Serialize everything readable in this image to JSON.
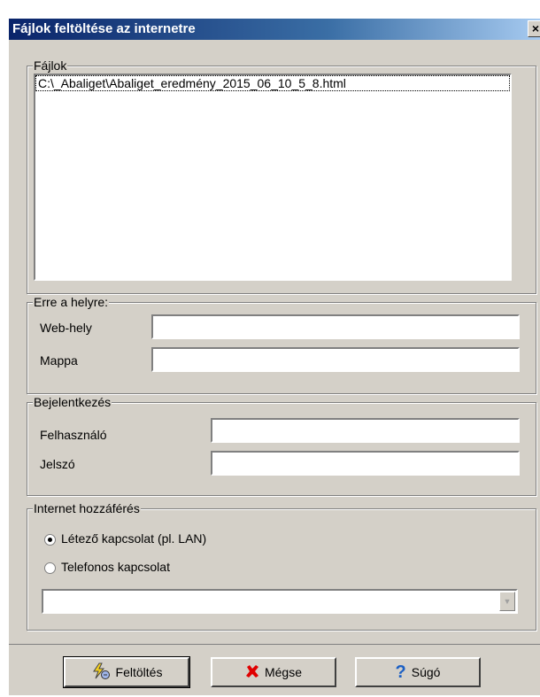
{
  "window": {
    "title": "Fájlok feltöltése az internetre",
    "close": "×"
  },
  "files": {
    "legend": "Fájlok",
    "items": [
      "C:\\_Abaliget\\Abaliget_eredmény_2015_06_10_5_8.html"
    ]
  },
  "destination": {
    "legend": "Erre a helyre:",
    "website_label": "Web-hely",
    "website_value": "",
    "folder_label": "Mappa",
    "folder_value": ""
  },
  "login": {
    "legend": "Bejelentkezés",
    "user_label": "Felhasználó",
    "user_value": "",
    "password_label": "Jelszó",
    "password_value": ""
  },
  "internet": {
    "legend": "Internet hozzáférés",
    "option_existing": "Létező kapcsolat (pl. LAN)",
    "option_dialup": "Telefonos kapcsolat",
    "selected": "existing",
    "connection_value": ""
  },
  "buttons": {
    "upload": "Feltöltés",
    "cancel": "Mégse",
    "help": "Súgó"
  },
  "icons": {
    "upload": "lightning-hand-icon",
    "cancel": "red-x-icon",
    "help": "question-mark-icon"
  },
  "colors": {
    "title_start": "#0a246a",
    "title_end": "#a6caf0",
    "face": "#d4d0c8",
    "cancel_x": "#e00000",
    "help_q": "#1b5fc4"
  }
}
